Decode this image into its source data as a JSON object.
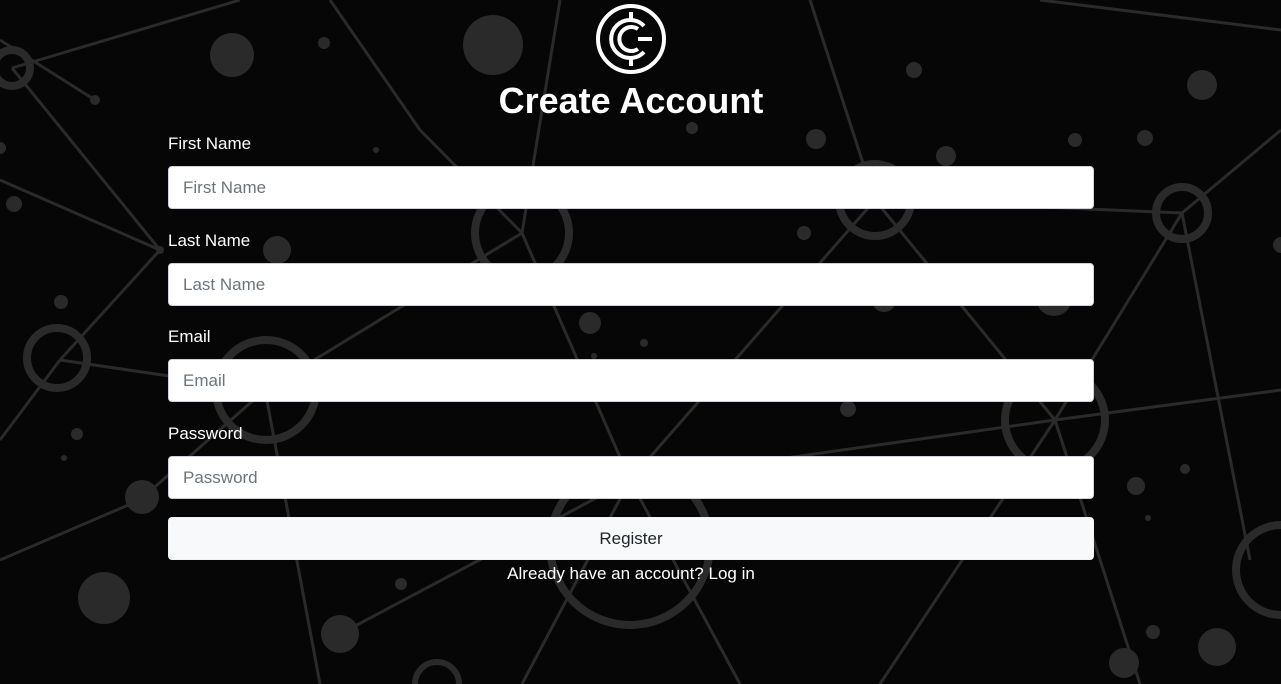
{
  "brand": {
    "logo_icon": "crypto-c-logo-icon",
    "logo_color": "#ffffff"
  },
  "page": {
    "title": "Create Account",
    "background_color": "#060606"
  },
  "form": {
    "fields": [
      {
        "label": "First Name",
        "placeholder": "First Name",
        "value": ""
      },
      {
        "label": "Last Name",
        "placeholder": "Last Name",
        "value": ""
      },
      {
        "label": "Email",
        "placeholder": "Email",
        "value": ""
      },
      {
        "label": "Password",
        "placeholder": "Password",
        "value": ""
      }
    ],
    "submit_label": "Register"
  },
  "footer": {
    "prompt_text": "Already have an account?",
    "login_link": "Log in"
  }
}
